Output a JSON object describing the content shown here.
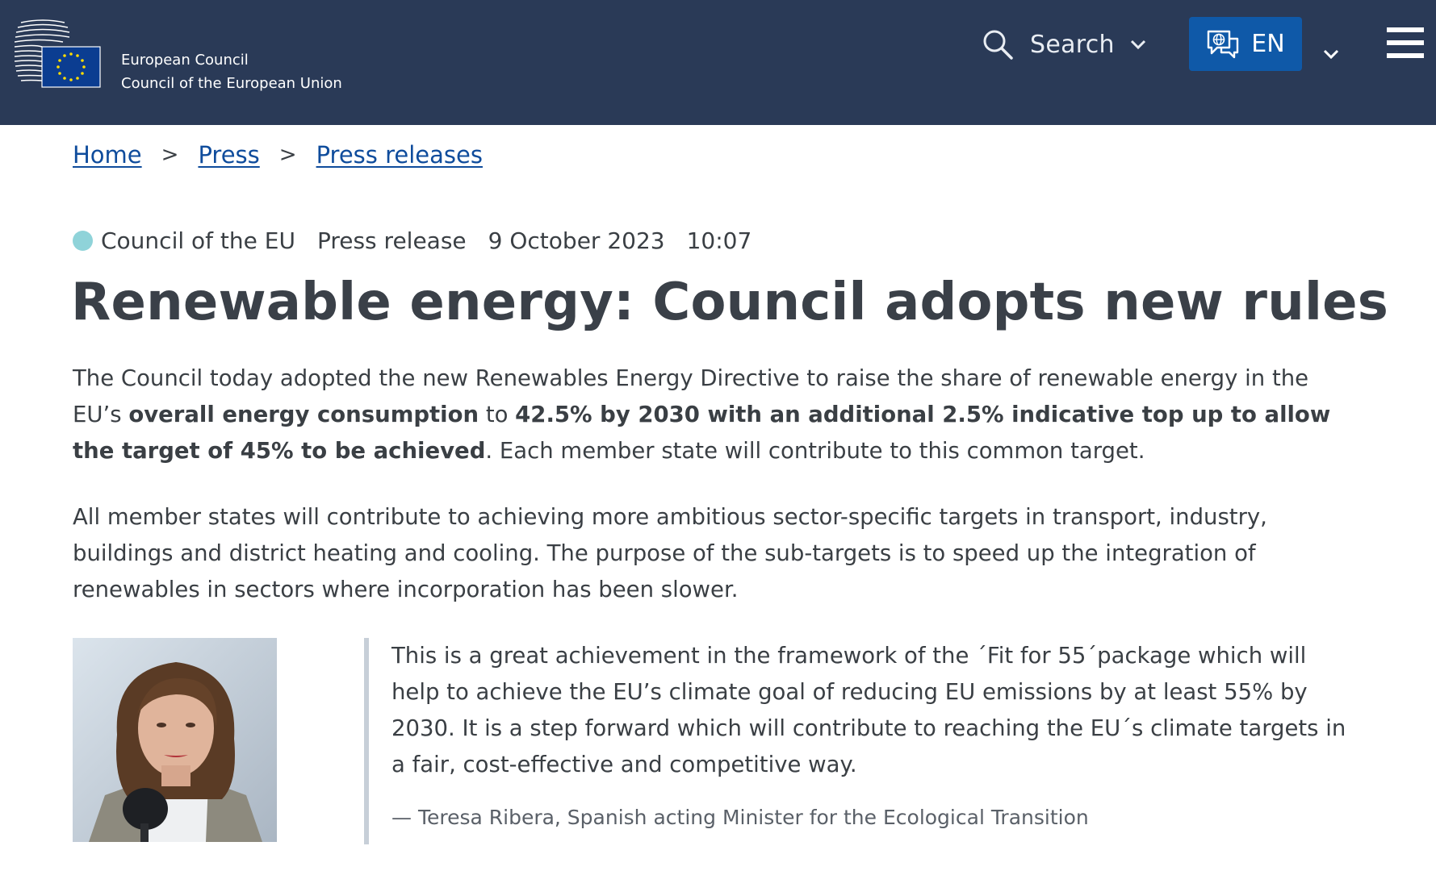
{
  "header": {
    "org_line1": "European Council",
    "org_line2": "Council of the European Union",
    "search_label": "Search",
    "lang_label": "EN"
  },
  "breadcrumb": {
    "items": [
      "Home",
      "Press",
      "Press releases"
    ],
    "separator": ">"
  },
  "meta": {
    "institution": "Council of the EU",
    "type": "Press release",
    "date": "9 October 2023",
    "time": "10:07",
    "dot_color": "#8fd3d9"
  },
  "article": {
    "title": "Renewable energy: Council adopts new rules",
    "p1_part1": "The Council today adopted the new Renewables Energy Directive to raise the share of renewable energy in the EU’s ",
    "p1_bold1": "overall energy consumption",
    "p1_part2": " to ",
    "p1_bold2": "42.5% by 2030 with an additional 2.5% indicative top up to allow the target of 45% to be achieved",
    "p1_part3": ". Each member state will contribute to this common target.",
    "p2": "All member states will contribute to achieving more ambitious sector-specific targets in transport, industry, buildings and district heating and cooling. The purpose of the sub-targets is to speed up the integration of renewables in sectors where incorporation has been slower."
  },
  "quote": {
    "text": "This is a great achievement in the framework of the ´Fit for 55´package which will help to achieve the EU’s climate goal of reducing EU emissions by at least 55% by 2030. It is a step forward which will contribute to reaching the EU´s climate targets in a fair, cost-effective and competitive way.",
    "author": "— Teresa Ribera, Spanish acting Minister for the Ecological Transition"
  },
  "colors": {
    "header_bg": "#2a3a57",
    "lang_button_bg": "#0f59a8",
    "link": "#0f4c9c",
    "quote_border": "#c7cfd8"
  },
  "icons": {
    "logo": "eu-council-logo",
    "search": "search-icon",
    "language": "language-chat-icon",
    "menu": "hamburger-menu-icon"
  }
}
